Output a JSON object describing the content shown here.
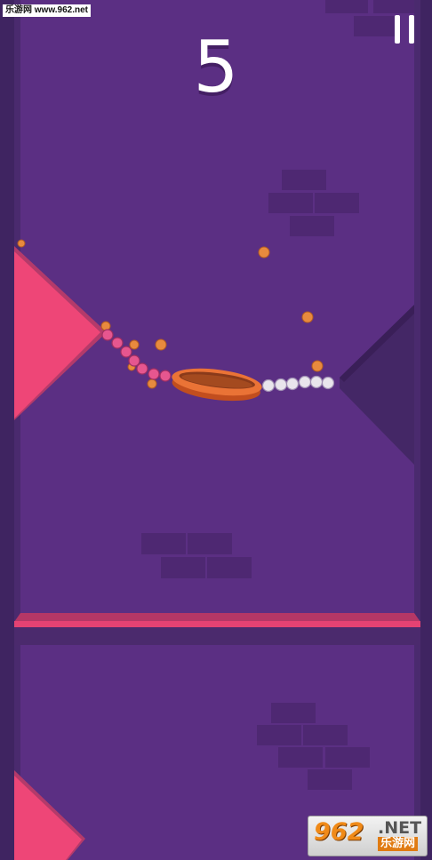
{
  "watermark": {
    "text": "乐游网 www.962.net"
  },
  "hud": {
    "score": "5",
    "pause_icon": "pause-icon"
  },
  "logo": {
    "number": "962",
    "suffix": ".NET",
    "chinese": "乐游网"
  },
  "colors": {
    "background": "#5b2f83",
    "wall": "#3f2461",
    "brick": "#4e2872",
    "spike": "#ee4677",
    "platform": "#e54273",
    "ball": "#e9713a",
    "pink_trail": "#e6568f",
    "white_trail": "#e9e5ec",
    "dot": "#e88a3e"
  }
}
